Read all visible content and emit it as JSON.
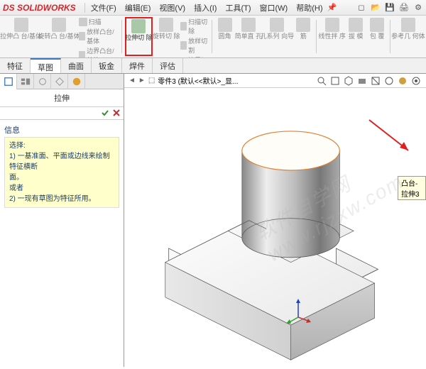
{
  "app": {
    "logo_prefix": "DS",
    "logo_name": "SOLIDWORKS"
  },
  "menu": {
    "file": "文件(F)",
    "edit": "编辑(E)",
    "view": "视图(V)",
    "insert": "插入(I)",
    "tools": "工具(T)",
    "window": "窗口(W)",
    "help": "帮助(H)"
  },
  "ribbon": {
    "extrude_boss": "拉伸凸\n台/基体",
    "revolve_boss": "旋转凸\n台/基体",
    "sweep": "扫描",
    "loft": "放样凸台/基体",
    "boundary": "边界凸台/基体",
    "extrude_cut": "拉伸切\n除",
    "revolve_cut": "旋转切\n除",
    "sweep_cut": "扫描切除",
    "loft_cut": "放样切割",
    "boundary_cut": "边界切割",
    "fillet": "圆角",
    "pattern": "简单直\n孔",
    "hole_wizard": "孔系列\n向导",
    "rib": "筋",
    "linear_pattern": "线性拌\n序",
    "draft": "拔\n模",
    "shell": "包\n覆",
    "ref_geom": "参考几\n何体"
  },
  "tabs": {
    "features": "特征",
    "sketch": "草图",
    "surfaces": "曲面",
    "sheetmetal": "钣金",
    "weldments": "焊件",
    "evaluate": "评估"
  },
  "panel": {
    "title": "拉伸"
  },
  "info": {
    "header": "信息",
    "label_select": "选择:",
    "line1": "1) 一基准面、平面或边线来绘制特征横断\n面。",
    "or": "或者",
    "line2": "2) 一现有草图为特征所用。"
  },
  "doc": {
    "name": "零件3  (默认<<默认>_显..."
  },
  "tooltip": {
    "text": "凸台-拉伸3"
  },
  "watermark": "软件自学网\nwww.rjzxw.com"
}
